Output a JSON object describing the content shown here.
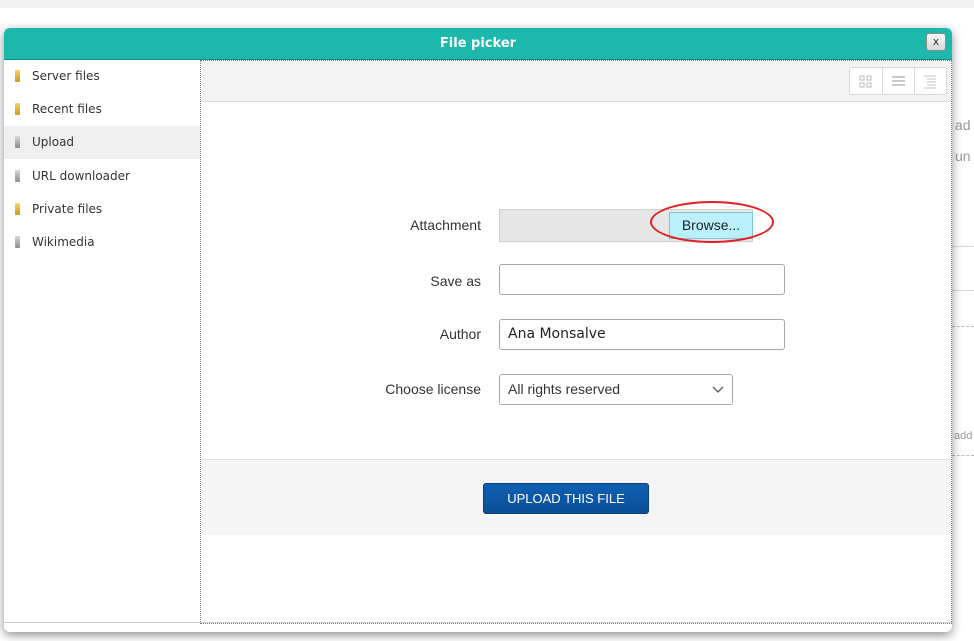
{
  "dialog": {
    "title": "File picker",
    "close_label": "x"
  },
  "sidebar": {
    "items": [
      {
        "label": "Server files",
        "icon": "server-files-icon"
      },
      {
        "label": "Recent files",
        "icon": "recent-files-icon"
      },
      {
        "label": "Upload",
        "icon": "upload-icon",
        "active": true
      },
      {
        "label": "URL downloader",
        "icon": "url-downloader-icon"
      },
      {
        "label": "Private files",
        "icon": "private-files-icon"
      },
      {
        "label": "Wikimedia",
        "icon": "wikimedia-icon"
      }
    ]
  },
  "toolbar": {
    "views": [
      "icons-view",
      "details-view",
      "tree-view"
    ]
  },
  "form": {
    "attachment_label": "Attachment",
    "browse_label": "Browse...",
    "save_as_label": "Save as",
    "save_as_value": "",
    "author_label": "Author",
    "author_value": "Ana Monsalve",
    "license_label": "Choose license",
    "license_value": "All rights reserved"
  },
  "upload_button": "UPLOAD THIS FILE",
  "background": {
    "text1": "ad",
    "text2": "un",
    "text3": "add"
  },
  "colors": {
    "titlebar": "#1db8ac",
    "upload_button": "#0f5fb0",
    "browse_highlight": "#b9f0fb",
    "annotation_ring": "#e02020"
  }
}
